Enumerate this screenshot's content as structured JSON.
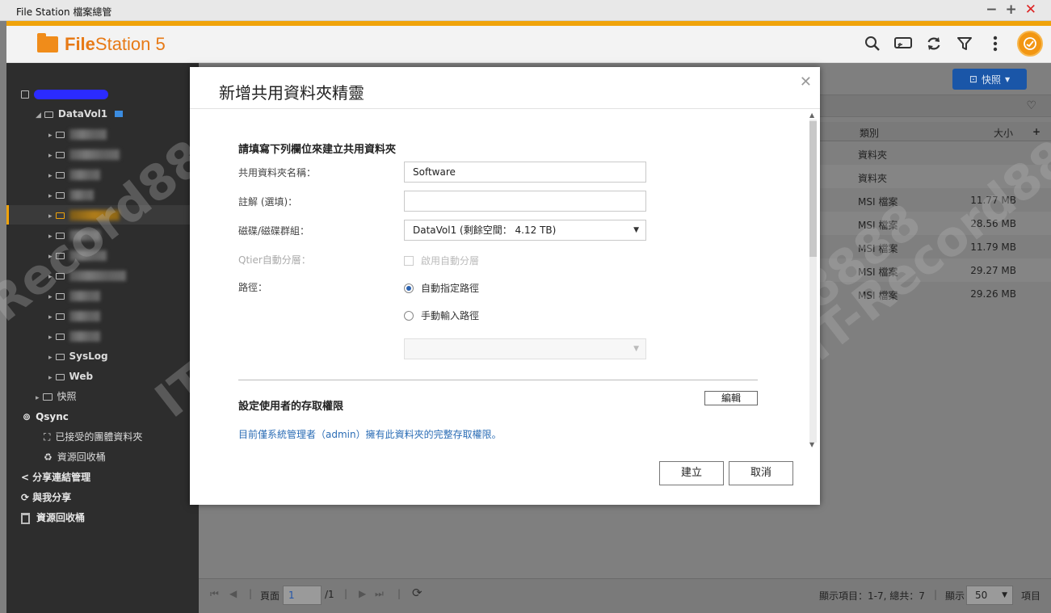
{
  "window": {
    "title": "File Station 檔案總管",
    "controls": {
      "minimize": "−",
      "maximize": "+",
      "close": "✕"
    }
  },
  "header": {
    "app_name_bold": "File",
    "app_name_light": "Station 5",
    "icons": [
      "search-icon",
      "cast-icon",
      "refresh-icon",
      "filter-icon",
      "more-icon",
      "status-icon"
    ]
  },
  "sidebar": {
    "volume": "DataVol1",
    "folders": {
      "syslog": "SysLog",
      "web": "Web"
    },
    "snapshot": "快照",
    "qsync": "Qsync",
    "qsync_items": [
      "已接受的團體資料夾",
      "資源回收桶"
    ],
    "share_link_mgmt": "分享連結管理",
    "shared_with_me": "與我分享",
    "recycle_bin": "資源回收桶"
  },
  "main": {
    "snapshot_button": "快照",
    "columns": {
      "type": "類別",
      "size": "大小"
    },
    "rows": [
      {
        "type": "資料夾",
        "size": ""
      },
      {
        "type": "資料夾",
        "size": ""
      },
      {
        "type": "MSI 檔案",
        "size": "11.77 MB"
      },
      {
        "type": "MSI 檔案",
        "size": "28.56 MB"
      },
      {
        "type": "MSI 檔案",
        "size": "11.79 MB"
      },
      {
        "type": "MSI 檔案",
        "size": "29.27 MB"
      },
      {
        "type": "MSI 檔案",
        "size": "29.26 MB"
      }
    ]
  },
  "footer": {
    "page_label": "頁面",
    "page_value": "1",
    "page_total": "/1",
    "items_label": "顯示項目：1-7, 總共：7",
    "show_label": "顯示",
    "per_page": "50",
    "items_suffix": "項目"
  },
  "dialog": {
    "title": "新增共用資料夾精靈",
    "section1": "請填寫下列欄位來建立共用資料夾",
    "name_label": "共用資料夾名稱：",
    "name_value": "Software",
    "comment_label": "註解 (選填)：",
    "comment_value": "",
    "disk_label": "磁碟/磁碟群組：",
    "disk_value": "DataVol1 (剩餘空間： 4.12 TB)",
    "qtier_label": "Qtier自動分層：",
    "qtier_checkbox": "啟用自動分層",
    "path_label": "路徑：",
    "path_auto": "自動指定路徑",
    "path_manual": "手動輸入路徑",
    "section2": "設定使用者的存取權限",
    "edit_button": "編輯",
    "note": "目前僅系統管理者（admin）擁有此資料夾的完整存取權限。",
    "create_button": "建立",
    "cancel_button": "取消"
  },
  "watermark": "IT-Record8888"
}
